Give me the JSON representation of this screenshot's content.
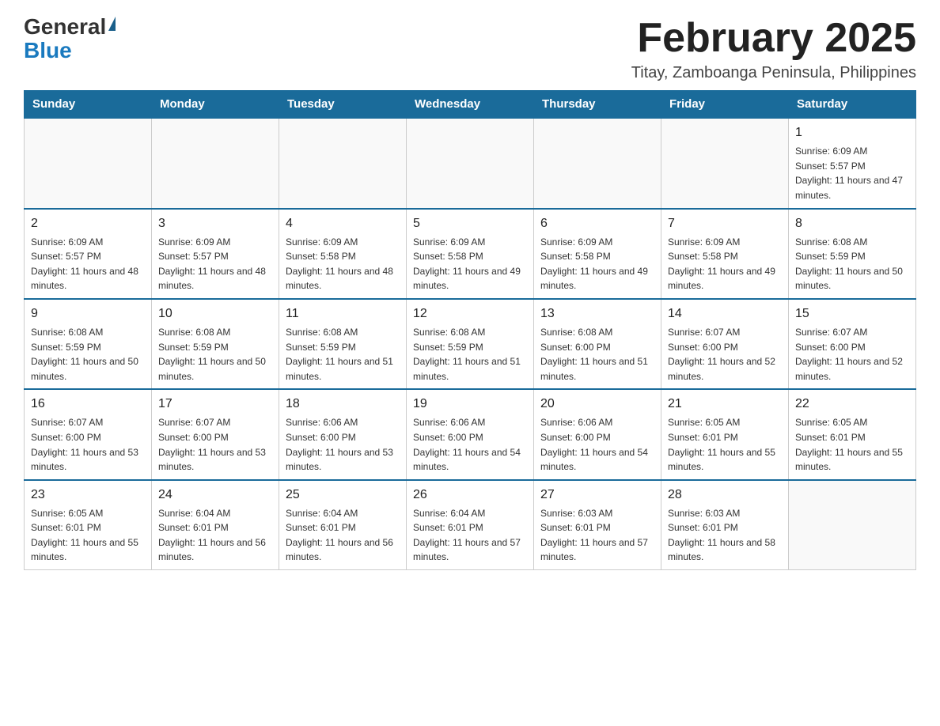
{
  "logo": {
    "general": "General",
    "blue": "Blue"
  },
  "header": {
    "title": "February 2025",
    "subtitle": "Titay, Zamboanga Peninsula, Philippines"
  },
  "days_of_week": [
    "Sunday",
    "Monday",
    "Tuesday",
    "Wednesday",
    "Thursday",
    "Friday",
    "Saturday"
  ],
  "weeks": [
    [
      {
        "day": "",
        "info": ""
      },
      {
        "day": "",
        "info": ""
      },
      {
        "day": "",
        "info": ""
      },
      {
        "day": "",
        "info": ""
      },
      {
        "day": "",
        "info": ""
      },
      {
        "day": "",
        "info": ""
      },
      {
        "day": "1",
        "info": "Sunrise: 6:09 AM\nSunset: 5:57 PM\nDaylight: 11 hours and 47 minutes."
      }
    ],
    [
      {
        "day": "2",
        "info": "Sunrise: 6:09 AM\nSunset: 5:57 PM\nDaylight: 11 hours and 48 minutes."
      },
      {
        "day": "3",
        "info": "Sunrise: 6:09 AM\nSunset: 5:57 PM\nDaylight: 11 hours and 48 minutes."
      },
      {
        "day": "4",
        "info": "Sunrise: 6:09 AM\nSunset: 5:58 PM\nDaylight: 11 hours and 48 minutes."
      },
      {
        "day": "5",
        "info": "Sunrise: 6:09 AM\nSunset: 5:58 PM\nDaylight: 11 hours and 49 minutes."
      },
      {
        "day": "6",
        "info": "Sunrise: 6:09 AM\nSunset: 5:58 PM\nDaylight: 11 hours and 49 minutes."
      },
      {
        "day": "7",
        "info": "Sunrise: 6:09 AM\nSunset: 5:58 PM\nDaylight: 11 hours and 49 minutes."
      },
      {
        "day": "8",
        "info": "Sunrise: 6:08 AM\nSunset: 5:59 PM\nDaylight: 11 hours and 50 minutes."
      }
    ],
    [
      {
        "day": "9",
        "info": "Sunrise: 6:08 AM\nSunset: 5:59 PM\nDaylight: 11 hours and 50 minutes."
      },
      {
        "day": "10",
        "info": "Sunrise: 6:08 AM\nSunset: 5:59 PM\nDaylight: 11 hours and 50 minutes."
      },
      {
        "day": "11",
        "info": "Sunrise: 6:08 AM\nSunset: 5:59 PM\nDaylight: 11 hours and 51 minutes."
      },
      {
        "day": "12",
        "info": "Sunrise: 6:08 AM\nSunset: 5:59 PM\nDaylight: 11 hours and 51 minutes."
      },
      {
        "day": "13",
        "info": "Sunrise: 6:08 AM\nSunset: 6:00 PM\nDaylight: 11 hours and 51 minutes."
      },
      {
        "day": "14",
        "info": "Sunrise: 6:07 AM\nSunset: 6:00 PM\nDaylight: 11 hours and 52 minutes."
      },
      {
        "day": "15",
        "info": "Sunrise: 6:07 AM\nSunset: 6:00 PM\nDaylight: 11 hours and 52 minutes."
      }
    ],
    [
      {
        "day": "16",
        "info": "Sunrise: 6:07 AM\nSunset: 6:00 PM\nDaylight: 11 hours and 53 minutes."
      },
      {
        "day": "17",
        "info": "Sunrise: 6:07 AM\nSunset: 6:00 PM\nDaylight: 11 hours and 53 minutes."
      },
      {
        "day": "18",
        "info": "Sunrise: 6:06 AM\nSunset: 6:00 PM\nDaylight: 11 hours and 53 minutes."
      },
      {
        "day": "19",
        "info": "Sunrise: 6:06 AM\nSunset: 6:00 PM\nDaylight: 11 hours and 54 minutes."
      },
      {
        "day": "20",
        "info": "Sunrise: 6:06 AM\nSunset: 6:00 PM\nDaylight: 11 hours and 54 minutes."
      },
      {
        "day": "21",
        "info": "Sunrise: 6:05 AM\nSunset: 6:01 PM\nDaylight: 11 hours and 55 minutes."
      },
      {
        "day": "22",
        "info": "Sunrise: 6:05 AM\nSunset: 6:01 PM\nDaylight: 11 hours and 55 minutes."
      }
    ],
    [
      {
        "day": "23",
        "info": "Sunrise: 6:05 AM\nSunset: 6:01 PM\nDaylight: 11 hours and 55 minutes."
      },
      {
        "day": "24",
        "info": "Sunrise: 6:04 AM\nSunset: 6:01 PM\nDaylight: 11 hours and 56 minutes."
      },
      {
        "day": "25",
        "info": "Sunrise: 6:04 AM\nSunset: 6:01 PM\nDaylight: 11 hours and 56 minutes."
      },
      {
        "day": "26",
        "info": "Sunrise: 6:04 AM\nSunset: 6:01 PM\nDaylight: 11 hours and 57 minutes."
      },
      {
        "day": "27",
        "info": "Sunrise: 6:03 AM\nSunset: 6:01 PM\nDaylight: 11 hours and 57 minutes."
      },
      {
        "day": "28",
        "info": "Sunrise: 6:03 AM\nSunset: 6:01 PM\nDaylight: 11 hours and 58 minutes."
      },
      {
        "day": "",
        "info": ""
      }
    ]
  ]
}
